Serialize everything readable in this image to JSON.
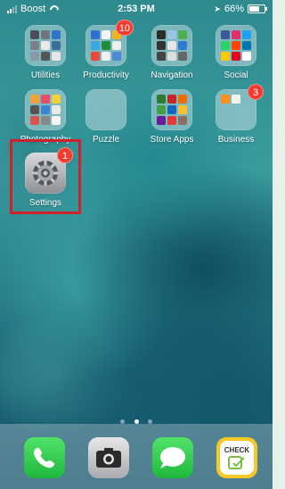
{
  "status_bar": {
    "carrier": "Boost",
    "time": "2:53 PM",
    "battery": "66%",
    "battery_level": 0.66
  },
  "home": {
    "apps": [
      {
        "name": "Utilities",
        "badge": null
      },
      {
        "name": "Productivity",
        "badge": "10"
      },
      {
        "name": "Navigation",
        "badge": null
      },
      {
        "name": "Social",
        "badge": null
      },
      {
        "name": "Photography",
        "badge": null
      },
      {
        "name": "Puzzle",
        "badge": null
      },
      {
        "name": "Store Apps",
        "badge": null
      },
      {
        "name": "Business",
        "badge": "3"
      },
      {
        "name": "Settings",
        "badge": "1",
        "icon": "gear-icon"
      }
    ]
  },
  "page_indicator": {
    "pages": 3,
    "current": 2
  },
  "dock": {
    "apps": [
      {
        "icon": "phone-icon"
      },
      {
        "icon": "camera-icon"
      },
      {
        "icon": "messages-icon"
      },
      {
        "icon": "check-app-icon",
        "text": "CHECK"
      }
    ]
  },
  "colors": {
    "badge": "#f23b30",
    "highlight": "#d21f2c"
  }
}
